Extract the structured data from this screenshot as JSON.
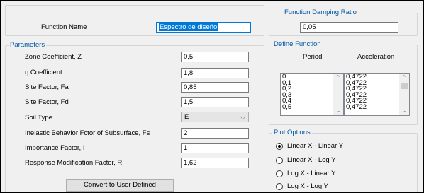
{
  "function_name": {
    "label": "Function Name",
    "value": "Espectro de diseño"
  },
  "damping": {
    "title": "Function Damping Ratio",
    "value": "0,05"
  },
  "parameters": {
    "title": "Parameters",
    "rows": [
      {
        "label": "Zone Coefficient, Z",
        "value": "0,5"
      },
      {
        "label": "η Coefficient",
        "value": "1,8"
      },
      {
        "label": "Site Factor, Fa",
        "value": "0,85"
      },
      {
        "label": "Site Factor, Fd",
        "value": "1,5"
      },
      {
        "label": "Soil Type",
        "value": "E"
      },
      {
        "label": "Inelastic Behavior Fctor of Subsurface, Fs",
        "value": "2"
      },
      {
        "label": "Importance Factor, I",
        "value": "1"
      },
      {
        "label": "Response Modification Factor, R",
        "value": "1,62"
      }
    ],
    "convert_button": "Convert to User Defined"
  },
  "define_function": {
    "title": "Define Function",
    "period_header": "Period",
    "acceleration_header": "Acceleration",
    "periods": [
      "0",
      "0,1",
      "0,2",
      "0,3",
      "0,4",
      "0,5"
    ],
    "accelerations": [
      "0,4722",
      "0,4722",
      "0,4722",
      "0,4722",
      "0,4722",
      "0,4722"
    ]
  },
  "plot_options": {
    "title": "Plot Options",
    "options": [
      {
        "label": "Linear X - Linear Y",
        "selected": true
      },
      {
        "label": "Linear X - Log Y",
        "selected": false
      },
      {
        "label": "Log X - Linear Y",
        "selected": false
      },
      {
        "label": "Log X - Log Y",
        "selected": false
      }
    ]
  },
  "icons": {
    "dropdown": "chevron-down-icon",
    "scroll_up": "scroll-up-arrow-icon",
    "scroll_down": "scroll-down-arrow-icon"
  }
}
